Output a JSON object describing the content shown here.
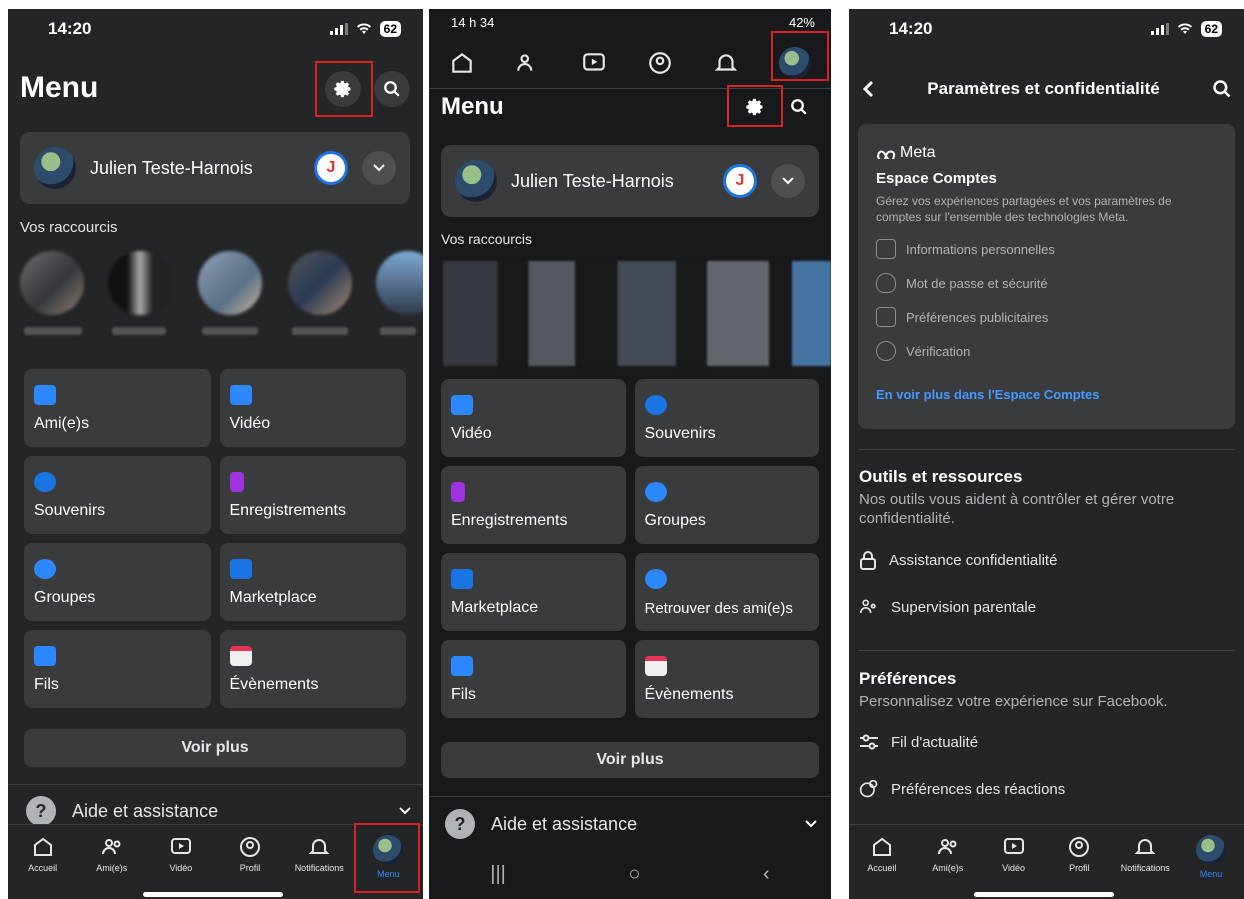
{
  "colors": {
    "accent": "#1b74e4",
    "highlight": "#d92323",
    "bg_dark": "#242526",
    "card": "#3a3b3c"
  },
  "screen1": {
    "time": "14:20",
    "battery": "62",
    "title": "Menu",
    "profile_name": "Julien Teste-Harnois",
    "shortcuts_label": "Vos raccourcis",
    "tiles": [
      "Ami(e)s",
      "Vidéo",
      "Souvenirs",
      "Enregistrements",
      "Groupes",
      "Marketplace",
      "Fils",
      "Évènements"
    ],
    "see_more": "Voir plus",
    "help": "Aide et assistance",
    "tabs": [
      "Accueil",
      "Ami(e)s",
      "Vidéo",
      "Profil",
      "Notifications",
      "Menu"
    ]
  },
  "screen2": {
    "time": "14 h 34",
    "battery": "42%",
    "title": "Menu",
    "profile_name": "Julien Teste-Harnois",
    "shortcuts_label": "Vos raccourcis",
    "tiles": [
      "Vidéo",
      "Souvenirs",
      "Enregistrements",
      "Groupes",
      "Marketplace",
      "Retrouver des ami(e)s",
      "Fils",
      "Évènements"
    ],
    "see_more": "Voir plus",
    "help": "Aide et assistance"
  },
  "screen3": {
    "time": "14:20",
    "battery": "62",
    "title": "Paramètres et confidentialité",
    "meta_brand": "Meta",
    "accounts_title": "Espace Comptes",
    "accounts_desc": "Gérez vos expériences partagées et vos paramètres de comptes sur l'ensemble des technologies Meta.",
    "accounts_items": [
      "Informations personnelles",
      "Mot de passe et sécurité",
      "Préférences publicitaires",
      "Vérification"
    ],
    "accounts_link": "En voir plus dans l'Espace Comptes",
    "tools_title": "Outils et ressources",
    "tools_desc": "Nos outils vous aident à contrôler et gérer votre confidentialité.",
    "tools_items": [
      "Assistance confidentialité",
      "Supervision parentale"
    ],
    "prefs_title": "Préférences",
    "prefs_desc": "Personnalisez votre expérience sur Facebook.",
    "prefs_items": [
      "Fil d'actualité",
      "Préférences des réactions"
    ],
    "tabs": [
      "Accueil",
      "Ami(e)s",
      "Vidéo",
      "Profil",
      "Notifications",
      "Menu"
    ]
  }
}
